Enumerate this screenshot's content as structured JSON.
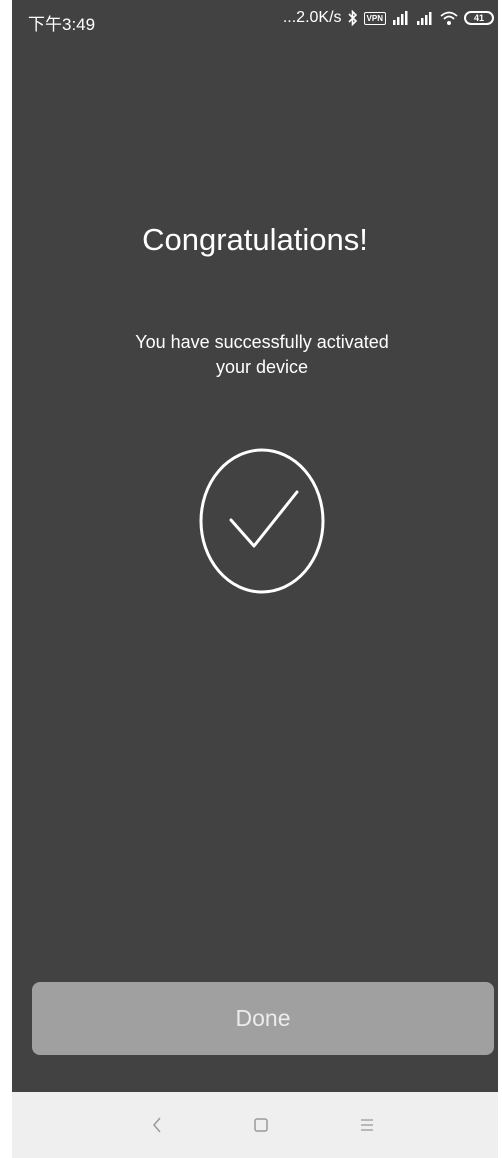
{
  "status_bar": {
    "time": "下午3:49",
    "network_speed": "...2.0K/s",
    "vpn_label": "VPN",
    "battery_level": "41"
  },
  "main": {
    "title": "Congratulations!",
    "message_line1": "You have successfully activated",
    "message_line2": "your device",
    "icon": "checkmark-circle-icon"
  },
  "actions": {
    "done_label": "Done"
  },
  "nav_bar": {
    "back_icon": "back-icon",
    "home_icon": "home-icon",
    "menu_icon": "menu-icon"
  },
  "colors": {
    "background": "#424242",
    "button": "#a0a0a0",
    "nav_bar": "#efefef"
  }
}
